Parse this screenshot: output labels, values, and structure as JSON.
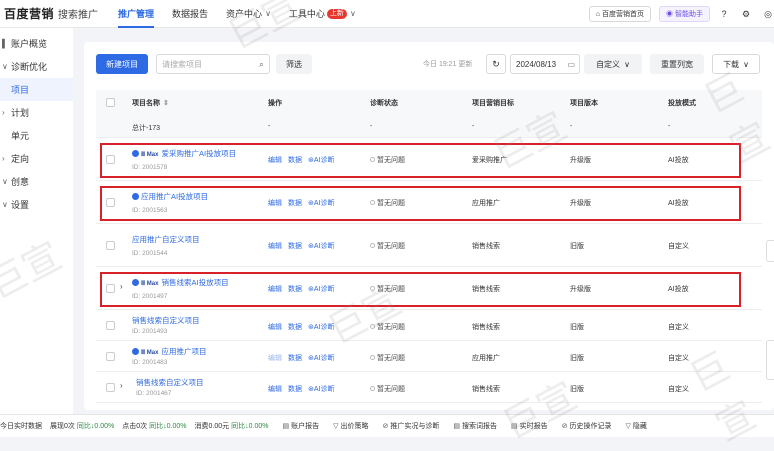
{
  "topbar": {
    "brand": "百度营销",
    "sub": "搜索推广",
    "nav": [
      {
        "label": "推广管理",
        "active": true
      },
      {
        "label": "数据报告",
        "active": false
      },
      {
        "label": "资产中心",
        "active": false
      },
      {
        "label": "工具中心",
        "active": false
      }
    ],
    "new_badge": "上新",
    "home_pill": "百度营销首页",
    "assistant_pill": "智能助手"
  },
  "sidebar": {
    "items": [
      {
        "label": "账户概览",
        "arrow": ""
      },
      {
        "label": "诊断优化",
        "arrow": "∨"
      },
      {
        "label": "项目",
        "arrow": "",
        "active": true
      },
      {
        "label": "计划",
        "arrow": "›"
      },
      {
        "label": "单元",
        "arrow": ""
      },
      {
        "label": "定向",
        "arrow": "›"
      },
      {
        "label": "创意",
        "arrow": "∨"
      },
      {
        "label": "设置",
        "arrow": "∨"
      }
    ]
  },
  "toolbar": {
    "new_button": "新建项目",
    "search_placeholder": "请搜索项目",
    "filter_button": "筛选",
    "update_text": "今日 19:21 更新",
    "date": "2024/08/13",
    "custom_button": "自定义",
    "reset_button": "重置列宽",
    "download_button": "下载"
  },
  "table": {
    "headers": [
      "项目名称",
      "操作",
      "诊断状态",
      "项目营销目标",
      "项目版本",
      "投放模式"
    ],
    "total": {
      "name": "总计-173",
      "op": "-",
      "diag": "-",
      "goal": "-",
      "version": "-",
      "mode": "-"
    },
    "rows": [
      {
        "max": true,
        "name": "爱采购推广AI投放项目",
        "id": "ID: 2001578",
        "ops": [
          "编辑",
          "数据",
          "AI诊断"
        ],
        "diag": "暂无问题",
        "goal": "爱采购推广",
        "version": "升级版",
        "mode": "AI投放",
        "expand": false
      },
      {
        "max": false,
        "name": "应用推广AI投放项目",
        "id": "ID: 2001563",
        "ops": [
          "编辑",
          "数据",
          "AI诊断"
        ],
        "diag": "暂无问题",
        "goal": "应用推广",
        "version": "升级版",
        "mode": "AI投放",
        "expand": false
      },
      {
        "max": false,
        "name": "应用推广自定义项目",
        "id": "ID: 2001544",
        "ops": [
          "编辑",
          "数据",
          "AI诊断"
        ],
        "diag": "暂无问题",
        "goal": "销售线索",
        "version": "旧版",
        "mode": "自定义",
        "expand": false
      },
      {
        "max": true,
        "name": "销售线索AI投放项目",
        "id": "ID: 2001497",
        "ops": [
          "编辑",
          "数据",
          "AI诊断"
        ],
        "diag": "暂无问题",
        "goal": "销售线索",
        "version": "升级版",
        "mode": "AI投放",
        "expand": true
      },
      {
        "max": false,
        "name": "销售线索自定义项目",
        "id": "ID: 2001493",
        "ops": [
          "编辑",
          "数据",
          "AI诊断"
        ],
        "diag": "暂无问题",
        "goal": "销售线索",
        "version": "旧版",
        "mode": "自定义",
        "expand": false
      },
      {
        "max": true,
        "name": "应用推广项目",
        "id": "ID: 2001483",
        "ops": [
          "编辑",
          "数据",
          "AI诊断"
        ],
        "diag": "暂无问题",
        "goal": "应用推广",
        "version": "旧版",
        "mode": "自定义",
        "expand": false
      },
      {
        "max": false,
        "name": "销售线索自定义项目",
        "id": "ID: 2001467",
        "ops": [
          "编辑",
          "数据",
          "AI诊断"
        ],
        "diag": "暂无问题",
        "goal": "销售线索",
        "version": "旧版",
        "mode": "自定义",
        "expand": true
      }
    ]
  },
  "statusbar": {
    "realtime": "今日实时数据",
    "show": "展现0次",
    "show_pct": "同比↓0.00%",
    "click": "点击0次",
    "click_pct": "同比↓0.00%",
    "spend": "消费0.00元",
    "spend_pct": "同比↓0.00%",
    "tools": [
      "账户报告",
      "出价策略",
      "推广实况与诊断",
      "搜索词报告",
      "实时报告",
      "历史操作记录",
      "隐藏"
    ]
  },
  "colors": {
    "accent": "#2d6ae3",
    "highlight": "#d8222a",
    "badge": "#e8372e"
  }
}
